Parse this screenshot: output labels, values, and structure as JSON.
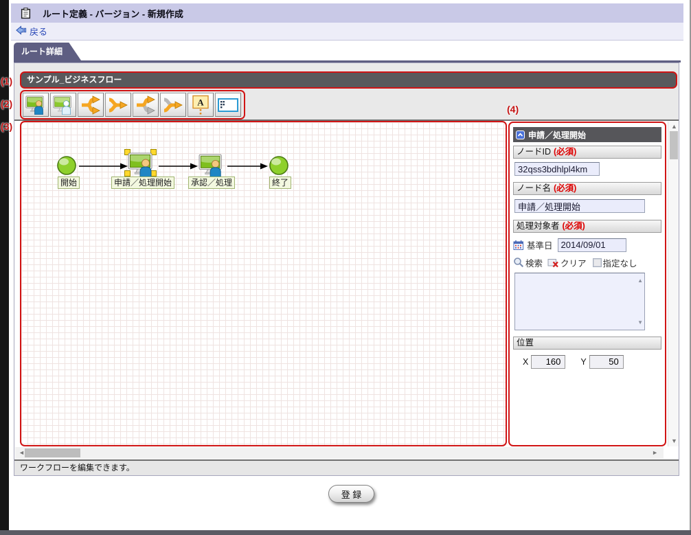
{
  "header": {
    "title": "ルート定義 - バージョン - 新規作成",
    "icon": "clipboard-icon"
  },
  "back": {
    "label": "戻る",
    "icon": "back-arrow-icon"
  },
  "tab": {
    "label": "ルート詳細"
  },
  "callouts": {
    "c1": "(1)",
    "c2": "(2)",
    "c3": "(3)",
    "c4": "(4)"
  },
  "flow": {
    "title": "サンプル_ビジネスフロー",
    "toolbar_icons": [
      "process-node-icon",
      "dynamic-process-node-icon",
      "branch-start-icon",
      "branch-join-icon",
      "sync-start-icon",
      "sync-join-icon",
      "annotation-icon",
      "swimlane-icon"
    ],
    "nodes": [
      {
        "type": "start",
        "label": "開始"
      },
      {
        "type": "task",
        "label": "申請／処理開始",
        "selected": true
      },
      {
        "type": "task",
        "label": "承認／処理"
      },
      {
        "type": "end",
        "label": "終了"
      }
    ],
    "status": "ワークフローを編集できます。"
  },
  "props": {
    "title": "申請／処理開始",
    "required": "(必須)",
    "node_id": {
      "label": "ノードID",
      "value": "32qss3bdhlpl4km"
    },
    "node_name": {
      "label": "ノード名",
      "value": "申請／処理開始"
    },
    "target": {
      "label": "処理対象者"
    },
    "base_date": {
      "label": "基準日",
      "value": "2014/09/01"
    },
    "search_label": "検索",
    "clear_label": "クリア",
    "no_select_label": "指定なし",
    "position": {
      "label": "位置",
      "x_label": "X",
      "x_value": "160",
      "y_label": "Y",
      "y_value": "50"
    }
  },
  "footer": {
    "register_label": "登 録"
  },
  "colors": {
    "callout_red": "#d01414",
    "titlebar": "#c9c9e7",
    "backbar": "#ededf8",
    "tab": "#5e5e82",
    "flow_title_bg": "#59595c",
    "props_header_bg": "#56565a",
    "required_red": "#dd0000",
    "node_green": "#8ed02c",
    "arrow_orange": "#f5a623",
    "link_blue": "#2b49b8",
    "input_bg": "#eaecfb",
    "label_box_bg": "#f3f8e0"
  }
}
